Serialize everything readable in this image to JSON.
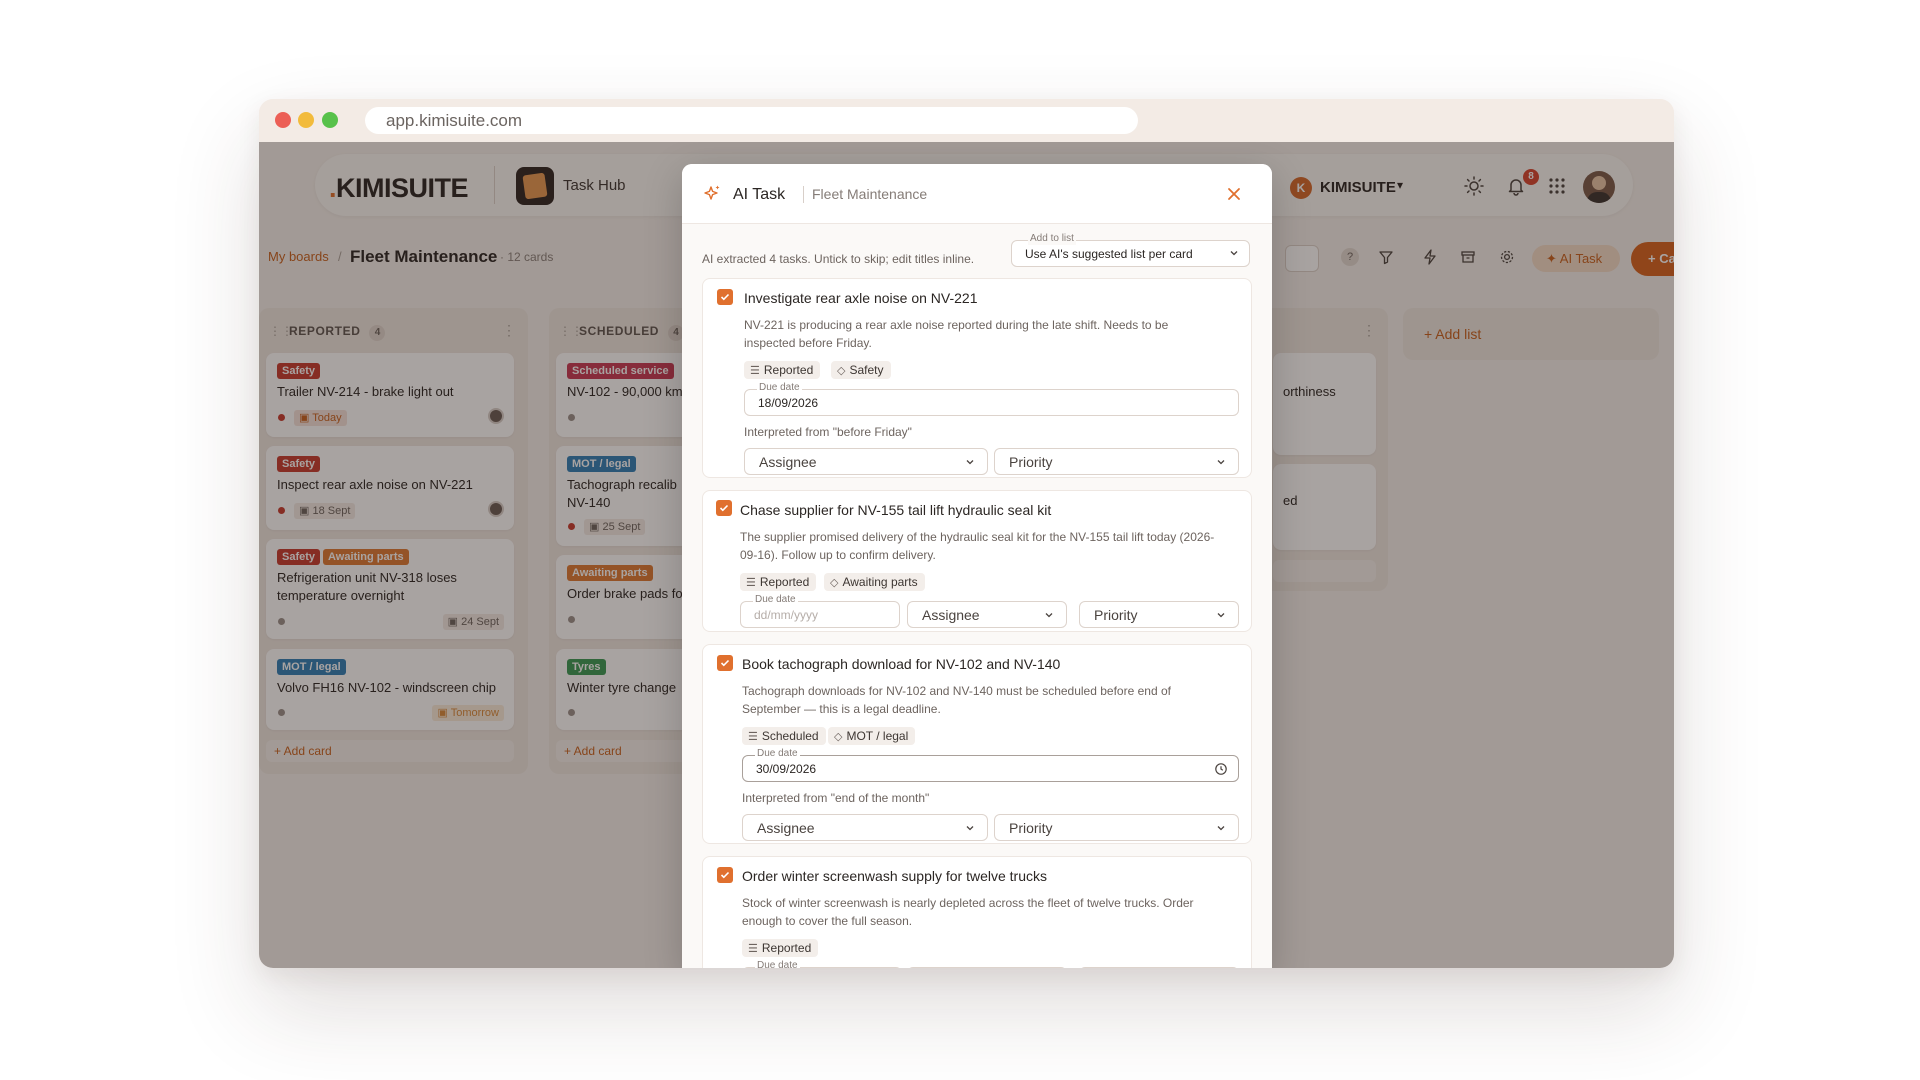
{
  "browser": {
    "url": "app.kimisuite.com"
  },
  "header": {
    "logo_dot": ".",
    "logo_text": "KIMISUITE",
    "app_name": "Task Hub",
    "workspace_initial": "K",
    "workspace_name": "KIMISUITE",
    "notification_count": "8",
    "icons": [
      "sun-icon",
      "bell-icon",
      "apps-grid-icon",
      "user-avatar"
    ]
  },
  "toolbar": {
    "breadcrumb_root": "My boards",
    "breadcrumb_sep": "/",
    "board_title": "Fleet Maintenance",
    "card_count": "· 12 cards",
    "help": "?",
    "ai_task_label": "AI Task",
    "create_label": "+ Ca"
  },
  "board": {
    "columns": [
      {
        "name": "REPORTED",
        "count": "4",
        "cards": [
          {
            "tags": [
              "Safety"
            ],
            "title": "Trailer NV-214 - brake light out",
            "date": "Today"
          },
          {
            "tags": [
              "Safety"
            ],
            "title": "Inspect rear axle noise on NV-221",
            "date": "18 Sept"
          },
          {
            "tags": [
              "Safety",
              "Awaiting parts"
            ],
            "title": "Refrigeration unit NV-318 loses temperature overnight",
            "date": "24 Sept"
          },
          {
            "tags": [
              "MOT / legal"
            ],
            "title": "Volvo FH16 NV-102 - windscreen chip",
            "date": "Tomorrow"
          }
        ],
        "add_card": "+ Add card"
      },
      {
        "name": "SCHEDULED",
        "count": "4",
        "cards": [
          {
            "tags": [
              "Scheduled service"
            ],
            "title": "NV-102 - 90,000 km"
          },
          {
            "tags": [
              "MOT / legal"
            ],
            "title": "Tachograph recalib NV-140",
            "date": "25 Sept"
          },
          {
            "tags": [
              "Awaiting parts"
            ],
            "title": "Order brake pads fo"
          },
          {
            "tags": [
              "Tyres"
            ],
            "title": "Winter tyre change"
          }
        ],
        "add_card": "+ Add card"
      },
      {
        "cards": [
          {
            "title": "orthiness"
          },
          {
            "title": "ed"
          }
        ]
      }
    ],
    "add_list": "+ Add list"
  },
  "modal": {
    "title": "AI Task",
    "subtitle": "Fleet Maintenance",
    "info": "AI extracted 4 tasks. Untick to skip; edit titles inline.",
    "add_to_list_label": "Add to list",
    "add_to_list_value": "Use AI's suggested list per card",
    "due_date_label": "Due date",
    "assignee_placeholder": "Assignee",
    "priority_placeholder": "Priority",
    "tasks": [
      {
        "title": "Investigate rear axle noise on NV-221",
        "description": "NV-221 is producing a rear axle noise reported during the late shift. Needs to be inspected before Friday.",
        "list": "Reported",
        "tag": "Safety",
        "due": "18/09/2026",
        "interpreted": "Interpreted from \"before Friday\""
      },
      {
        "title": "Chase supplier for NV-155 tail lift hydraulic seal kit",
        "description": "The supplier promised delivery of the hydraulic seal kit for the NV-155 tail lift today (2026-09-16). Follow up to confirm delivery.",
        "list": "Reported",
        "tag": "Awaiting parts",
        "due_placeholder": "dd/mm/yyyy"
      },
      {
        "title": "Book tachograph download for NV-102 and NV-140",
        "description": "Tachograph downloads for NV-102 and NV-140 must be scheduled before end of September — this is a legal deadline.",
        "list": "Scheduled",
        "tag": "MOT / legal",
        "due": "30/09/2026",
        "interpreted": "Interpreted from \"end of the month\""
      },
      {
        "title": "Order winter screenwash supply for twelve trucks",
        "description": "Stock of winter screenwash is nearly depleted across the fleet of twelve trucks. Order enough to cover the full season.",
        "list": "Reported"
      }
    ]
  },
  "colors": {
    "accent": "#e0702e",
    "safety": "#c73b30",
    "mot": "#2f7fb8",
    "scheduled": "#c83a55",
    "awaiting": "#de7a34",
    "tyres": "#3a9a55"
  }
}
